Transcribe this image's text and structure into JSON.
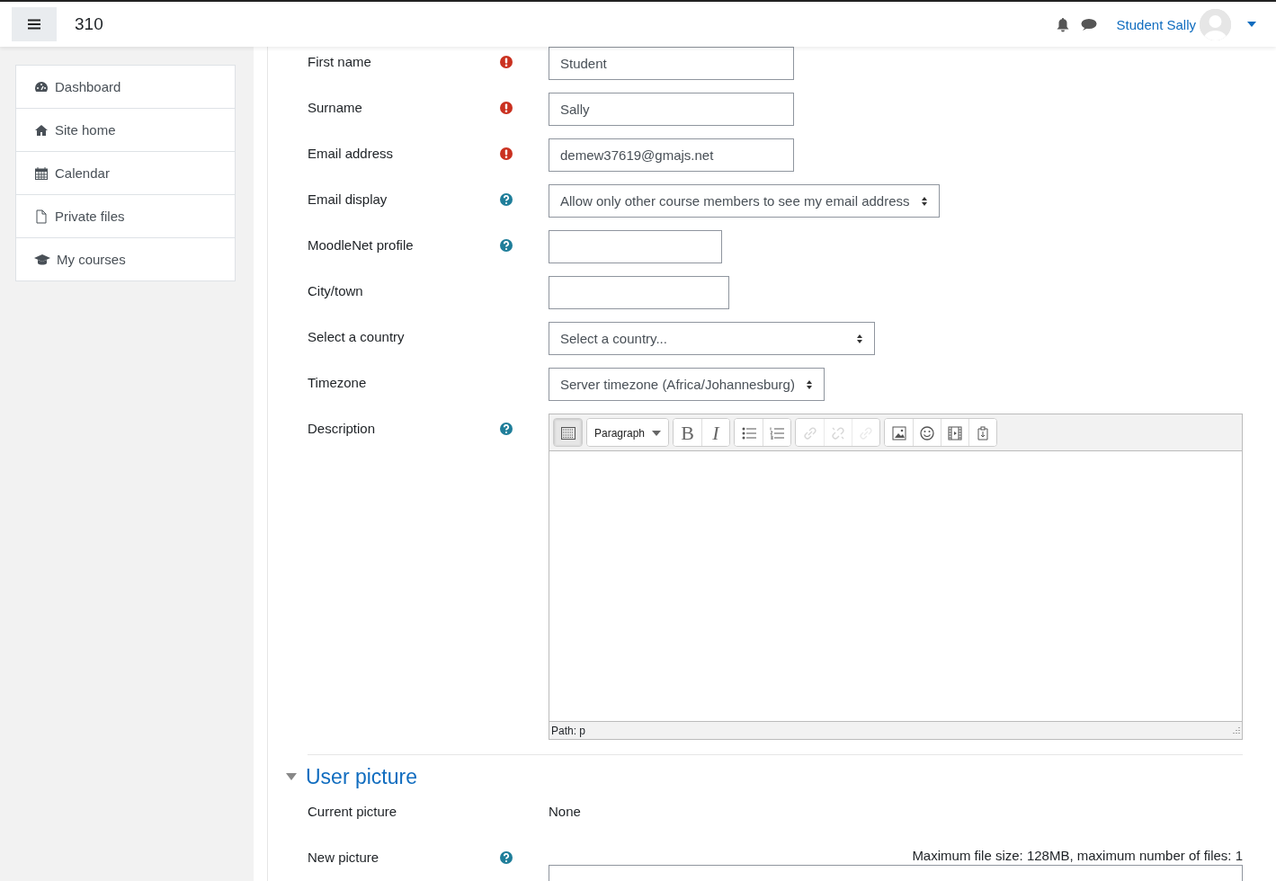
{
  "header": {
    "site_name": "310",
    "user_name": "Student Sally"
  },
  "sidebar": {
    "items": [
      {
        "label": "Dashboard",
        "selected": false
      },
      {
        "label": "Site home",
        "selected": false
      },
      {
        "label": "Calendar",
        "selected": false
      },
      {
        "label": "Private files",
        "selected": false
      },
      {
        "label": "My courses",
        "selected": false
      }
    ]
  },
  "form": {
    "rows": [
      {
        "label": "First name",
        "required": true,
        "help": false,
        "kind": "text",
        "value": "Student"
      },
      {
        "label": "Surname",
        "required": true,
        "help": false,
        "kind": "text",
        "value": "Sally"
      },
      {
        "label": "Email address",
        "required": true,
        "help": false,
        "kind": "text",
        "value": "demew37619@gmajs.net"
      },
      {
        "label": "Email display",
        "required": false,
        "help": true,
        "kind": "select",
        "value": "Allow only other course members to see my email address"
      },
      {
        "label": "MoodleNet profile",
        "required": false,
        "help": true,
        "kind": "text"
      },
      {
        "label": "City/town",
        "required": false,
        "help": false,
        "kind": "text"
      },
      {
        "label": "Select a country",
        "required": false,
        "help": false,
        "kind": "select",
        "value": "Select a country..."
      },
      {
        "label": "Timezone",
        "required": false,
        "help": false,
        "kind": "select",
        "value": "Server timezone (Africa/Johannesburg)"
      },
      {
        "label": "Description",
        "required": false,
        "help": true,
        "kind": "editor",
        "toolbar": [
          [
            {
              "kind": "more",
              "disabled": false,
              "on": true
            }
          ],
          [
            {
              "kind": "paragraph",
              "text": "Paragraph",
              "disabled": false,
              "on": false
            }
          ],
          [
            {
              "kind": "bold",
              "text": "B",
              "disabled": false,
              "on": false
            },
            {
              "kind": "italic",
              "text": "I",
              "disabled": false,
              "on": false
            }
          ],
          [
            {
              "kind": "bullets",
              "disabled": false,
              "on": false
            },
            {
              "kind": "numbers",
              "disabled": false,
              "on": false
            }
          ],
          [
            {
              "kind": "link",
              "disabled": true,
              "on": false
            },
            {
              "kind": "unlink",
              "disabled": true,
              "on": false
            },
            {
              "kind": "anchor",
              "disabled": true,
              "on": false
            }
          ],
          [
            {
              "kind": "image",
              "disabled": false,
              "on": false
            },
            {
              "kind": "emoji",
              "disabled": false,
              "on": false
            },
            {
              "kind": "media",
              "disabled": false,
              "on": false
            },
            {
              "kind": "paste",
              "disabled": false,
              "on": false
            }
          ]
        ],
        "path": "Path: p"
      }
    ]
  },
  "user_picture": {
    "title": "User picture",
    "expanded": true,
    "rows": [
      {
        "label": "Current picture",
        "required": false,
        "help": false,
        "kind": "static",
        "value": "None"
      },
      {
        "label": "New picture",
        "required": false,
        "help": true,
        "kind": "filepicker",
        "note": "Maximum file size: 128MB, maximum number of files: 1"
      }
    ]
  }
}
